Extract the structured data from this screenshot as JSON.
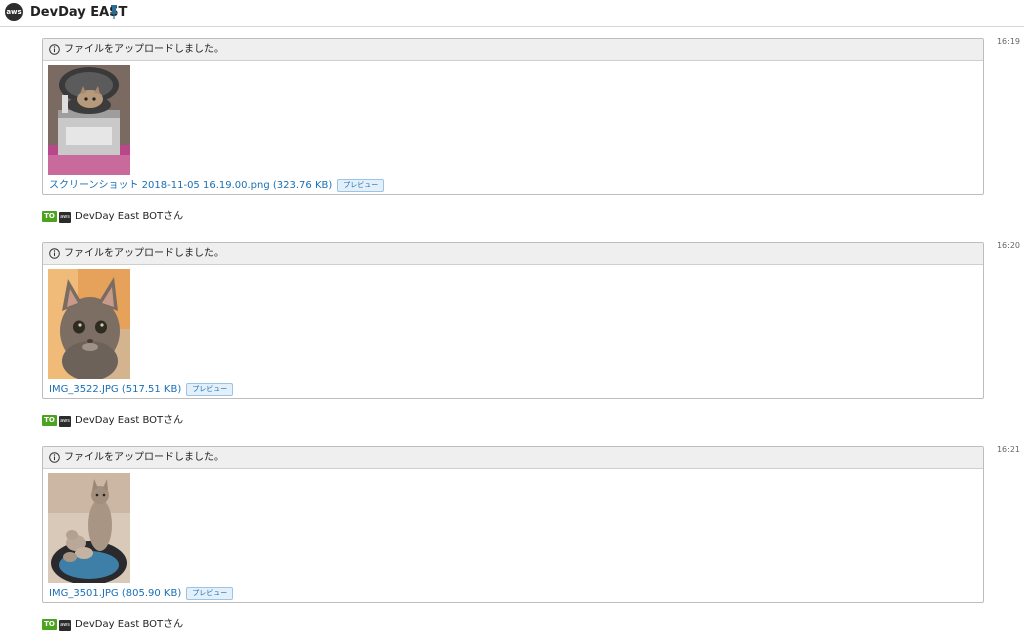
{
  "header": {
    "title": "DevDay EAST",
    "avatar_text": "aws",
    "pin_icon": "pin-icon"
  },
  "messages": [
    {
      "time": "16:19",
      "notice": "ファイルをアップロードしました。",
      "file_name": "スクリーンショット 2018-11-05 16.19.00.png (323.76 KB)",
      "preview_label": "プレビュー",
      "thumbnail": "cat-in-rice-cooker"
    },
    {
      "time": "16:20",
      "notice": "ファイルをアップロードしました。",
      "file_name": "IMG_3522.JPG (517.51 KB)",
      "preview_label": "プレビュー",
      "thumbnail": "kitten-face"
    },
    {
      "time": "16:21",
      "notice": "ファイルをアップロードしました。",
      "file_name": "IMG_3501.JPG (805.90 KB)",
      "preview_label": "プレビュー",
      "thumbnail": "cat-with-kittens"
    }
  ],
  "to_line": {
    "badge": "TO",
    "avatar_text": "aws",
    "recipient": "DevDay East BOTさん"
  },
  "colors": {
    "link": "#1a6fb5",
    "to_badge": "#4ca31f"
  }
}
